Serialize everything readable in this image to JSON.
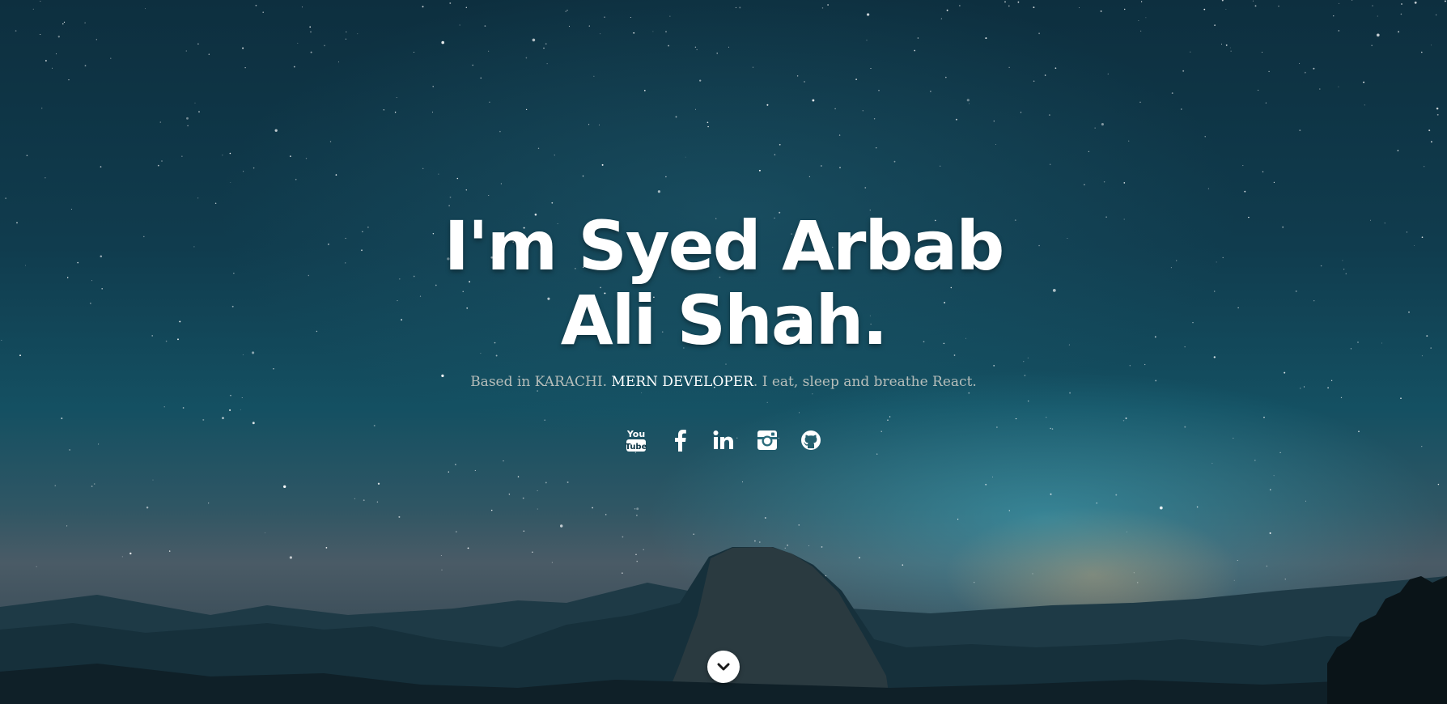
{
  "hero": {
    "headline": "I'm Syed Arbab Ali Shah.",
    "tagline": {
      "prefix": "Based in KARACHI. ",
      "emphasis": "MERN DEVELOPER",
      "suffix": ". I eat, sleep and breathe React."
    }
  },
  "social": [
    {
      "icon": "youtube-icon",
      "label": "YouTube"
    },
    {
      "icon": "facebook-icon",
      "label": "Facebook"
    },
    {
      "icon": "linkedin-icon",
      "label": "LinkedIn"
    },
    {
      "icon": "instagram-icon",
      "label": "Instagram"
    },
    {
      "icon": "github-icon",
      "label": "GitHub"
    }
  ],
  "scroll": {
    "icon": "chevron-down-icon"
  },
  "colors": {
    "sky_top": "#0d2f3f",
    "sky_glow": "#3caabe",
    "horizon_glow": "#e6965a",
    "text": "#ffffff"
  }
}
